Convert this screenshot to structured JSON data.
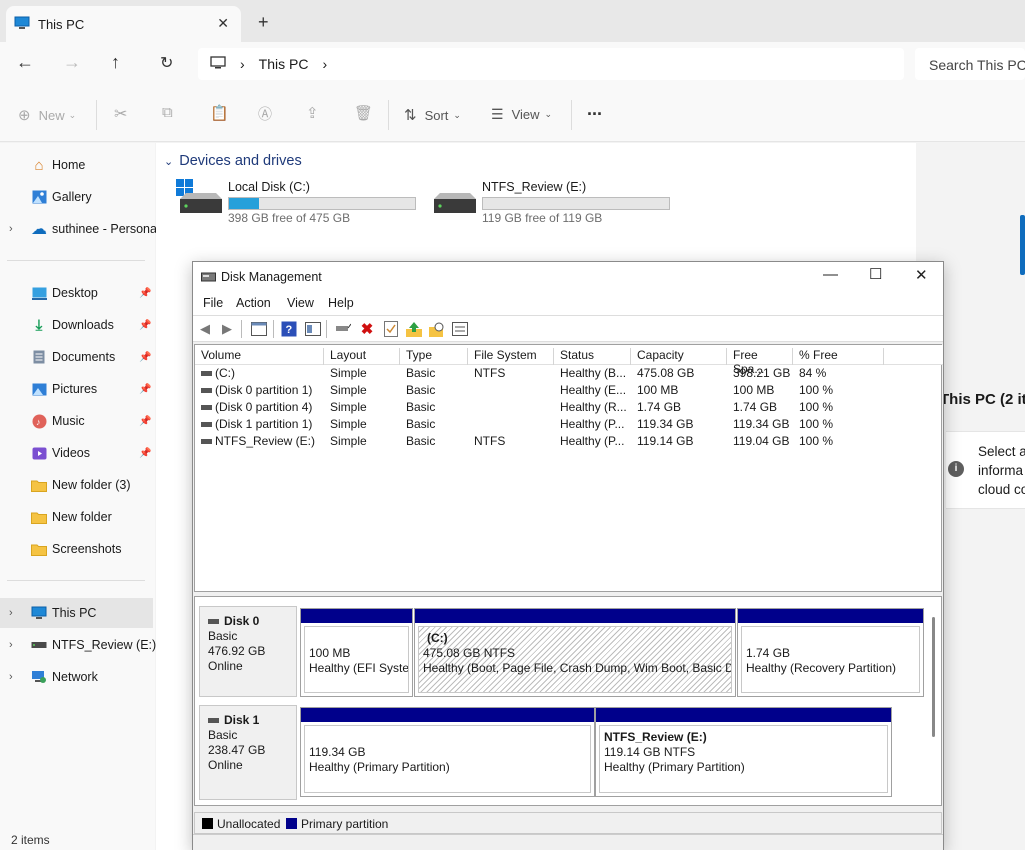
{
  "window": {
    "tab_title": "This PC",
    "search_placeholder": "Search This PC"
  },
  "breadcrumb": [
    "This PC"
  ],
  "toolbar": {
    "new": "New",
    "sort": "Sort",
    "view": "View",
    "more": "..."
  },
  "sidebar": {
    "top": [
      {
        "label": "Home"
      },
      {
        "label": "Gallery"
      },
      {
        "label": "suthinee - Personal"
      }
    ],
    "pinned": [
      {
        "label": "Desktop"
      },
      {
        "label": "Downloads"
      },
      {
        "label": "Documents"
      },
      {
        "label": "Pictures"
      },
      {
        "label": "Music"
      },
      {
        "label": "Videos"
      },
      {
        "label": "New folder (3)"
      },
      {
        "label": "New folder"
      },
      {
        "label": "Screenshots"
      }
    ],
    "bottom": [
      {
        "label": "This PC"
      },
      {
        "label": "NTFS_Review (E:)"
      },
      {
        "label": "Network"
      }
    ]
  },
  "status": "2 items",
  "main": {
    "section": "Devices and drives",
    "drives": [
      {
        "name": "Local Disk (C:)",
        "free_text": "398 GB free of 475 GB",
        "used_fraction": 0.16
      },
      {
        "name": "NTFS_Review (E:)",
        "free_text": "119 GB free of 119 GB",
        "used_fraction": 0.0
      }
    ]
  },
  "details": {
    "title": "This PC (2 ite",
    "info_lines": [
      "Select a",
      "informa",
      "cloud co"
    ]
  },
  "disk_management": {
    "title": "Disk Management",
    "menu": [
      "File",
      "Action",
      "View",
      "Help"
    ],
    "columns": [
      "Volume",
      "Layout",
      "Type",
      "File System",
      "Status",
      "Capacity",
      "Free Spa...",
      "% Free"
    ],
    "volumes": [
      [
        "(C:)",
        "Simple",
        "Basic",
        "NTFS",
        "Healthy (B...",
        "475.08 GB",
        "398.21 GB",
        "84 %"
      ],
      [
        "(Disk 0 partition 1)",
        "Simple",
        "Basic",
        "",
        "Healthy (E...",
        "100 MB",
        "100 MB",
        "100 %"
      ],
      [
        "(Disk 0 partition 4)",
        "Simple",
        "Basic",
        "",
        "Healthy (R...",
        "1.74 GB",
        "1.74 GB",
        "100 %"
      ],
      [
        "(Disk 1 partition 1)",
        "Simple",
        "Basic",
        "",
        "Healthy (P...",
        "119.34 GB",
        "119.34 GB",
        "100 %"
      ],
      [
        "NTFS_Review (E:)",
        "Simple",
        "Basic",
        "NTFS",
        "Healthy (P...",
        "119.14 GB",
        "119.04 GB",
        "100 %"
      ]
    ],
    "disks": [
      {
        "name": "Disk 0",
        "type": "Basic",
        "size": "476.92 GB",
        "state": "Online",
        "partitions": [
          {
            "title": "",
            "line1": "100 MB",
            "line2": "Healthy (EFI Syster"
          },
          {
            "title": "(C:)",
            "line1": "475.08 GB NTFS",
            "line2": "Healthy (Boot, Page File, Crash Dump, Wim Boot, Basic Da"
          },
          {
            "title": "",
            "line1": "1.74 GB",
            "line2": "Healthy (Recovery Partition)"
          }
        ]
      },
      {
        "name": "Disk 1",
        "type": "Basic",
        "size": "238.47 GB",
        "state": "Online",
        "partitions": [
          {
            "title": "",
            "line1": "119.34 GB",
            "line2": "Healthy (Primary Partition)"
          },
          {
            "title": "NTFS_Review  (E:)",
            "line1": "119.14 GB NTFS",
            "line2": "Healthy (Primary Partition)"
          }
        ]
      }
    ],
    "legend": [
      {
        "label": "Unallocated",
        "color": "#000000"
      },
      {
        "label": "Primary partition",
        "color": "#00008b"
      }
    ]
  }
}
